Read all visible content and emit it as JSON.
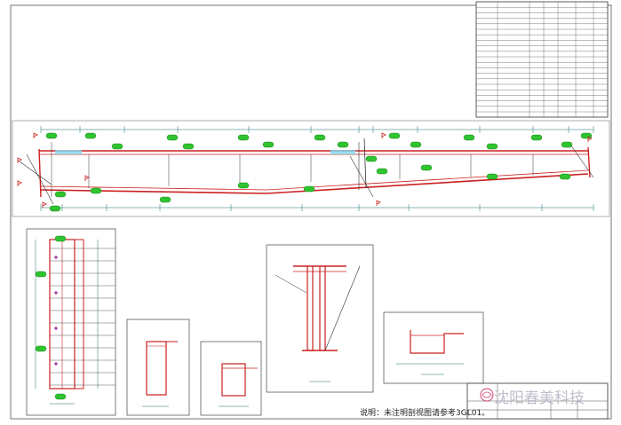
{
  "drawing": {
    "note": "说明：未注明剖视图请参考3GL01。",
    "watermark": "沈阳春美科技"
  },
  "colors": {
    "line": "#333333",
    "member": "#cc2020",
    "dim": "#1a6f6f",
    "tag_fill": "#2fc42f",
    "tag_stroke": "#0a6a0a",
    "bolt": "#8a0a8a",
    "marker": "#22aa22",
    "highlight": "#7fd8f0",
    "watermark_mark": "#d04070"
  }
}
